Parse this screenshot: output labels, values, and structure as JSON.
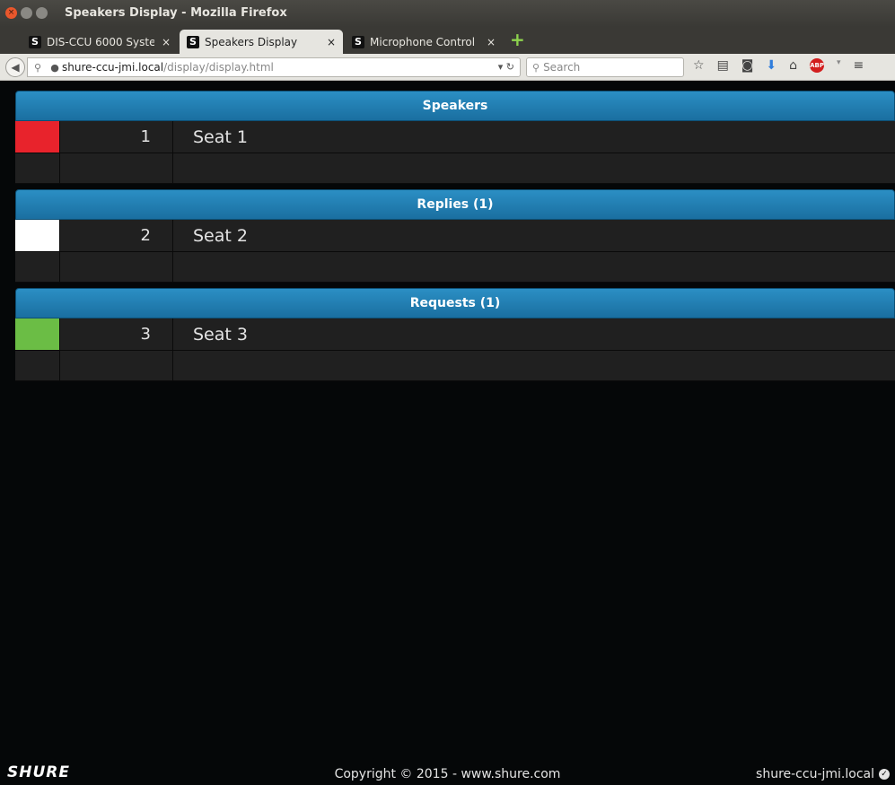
{
  "window": {
    "title": "Speakers Display - Mozilla Firefox"
  },
  "tabs": [
    {
      "label": "DIS-CCU 6000 Syste...",
      "favicon": "S"
    },
    {
      "label": "Speakers Display",
      "favicon": "S"
    },
    {
      "label": "Microphone Control",
      "favicon": "S"
    }
  ],
  "nav": {
    "url_host": "shure-ccu-jmi.local",
    "url_path": "/display/display.html",
    "search_placeholder": "Search"
  },
  "sections": [
    {
      "title": "Speakers",
      "seat_number": "1",
      "seat_name": "Seat 1",
      "color": "#e8232c"
    },
    {
      "title": "Replies (1)",
      "seat_number": "2",
      "seat_name": "Seat 2",
      "color": "#ffffff"
    },
    {
      "title": "Requests (1)",
      "seat_number": "3",
      "seat_name": "Seat 3",
      "color": "#6bbd45"
    }
  ],
  "footer": {
    "logo": "SHURE",
    "copyright": "Copyright © 2015 - www.shure.com",
    "host": "shure-ccu-jmi.local"
  }
}
